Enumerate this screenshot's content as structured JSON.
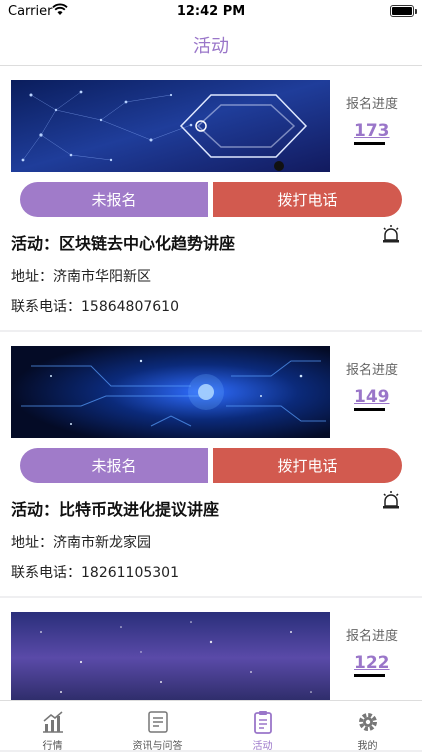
{
  "status": {
    "carrier": "Carrier",
    "time": "12:42 PM"
  },
  "nav": {
    "title": "活动"
  },
  "cards": [
    {
      "progress_label": "报名进度",
      "progress_value": "173",
      "signup_label": "未报名",
      "call_label": "拨打电话",
      "activity": "活动：区块链去中心化趋势讲座",
      "address": "地址：济南市华阳新区",
      "phone": "联系电话：15864807610"
    },
    {
      "progress_label": "报名进度",
      "progress_value": "149",
      "signup_label": "未报名",
      "call_label": "拨打电话",
      "activity": "活动：比特币改进化提议讲座",
      "address": "地址：济南市新龙家园",
      "phone": "联系电话：18261105301"
    },
    {
      "progress_label": "报名进度",
      "progress_value": "122"
    }
  ],
  "tabs": [
    {
      "label": "行情",
      "icon": "chart-icon"
    },
    {
      "label": "资讯与问答",
      "icon": "news-icon"
    },
    {
      "label": "活动",
      "icon": "activity-icon"
    },
    {
      "label": "我的",
      "icon": "gear-icon"
    }
  ],
  "colors": {
    "accent": "#9a76c9",
    "signup_button": "#a07bc9",
    "call_button": "#d25a4f"
  }
}
